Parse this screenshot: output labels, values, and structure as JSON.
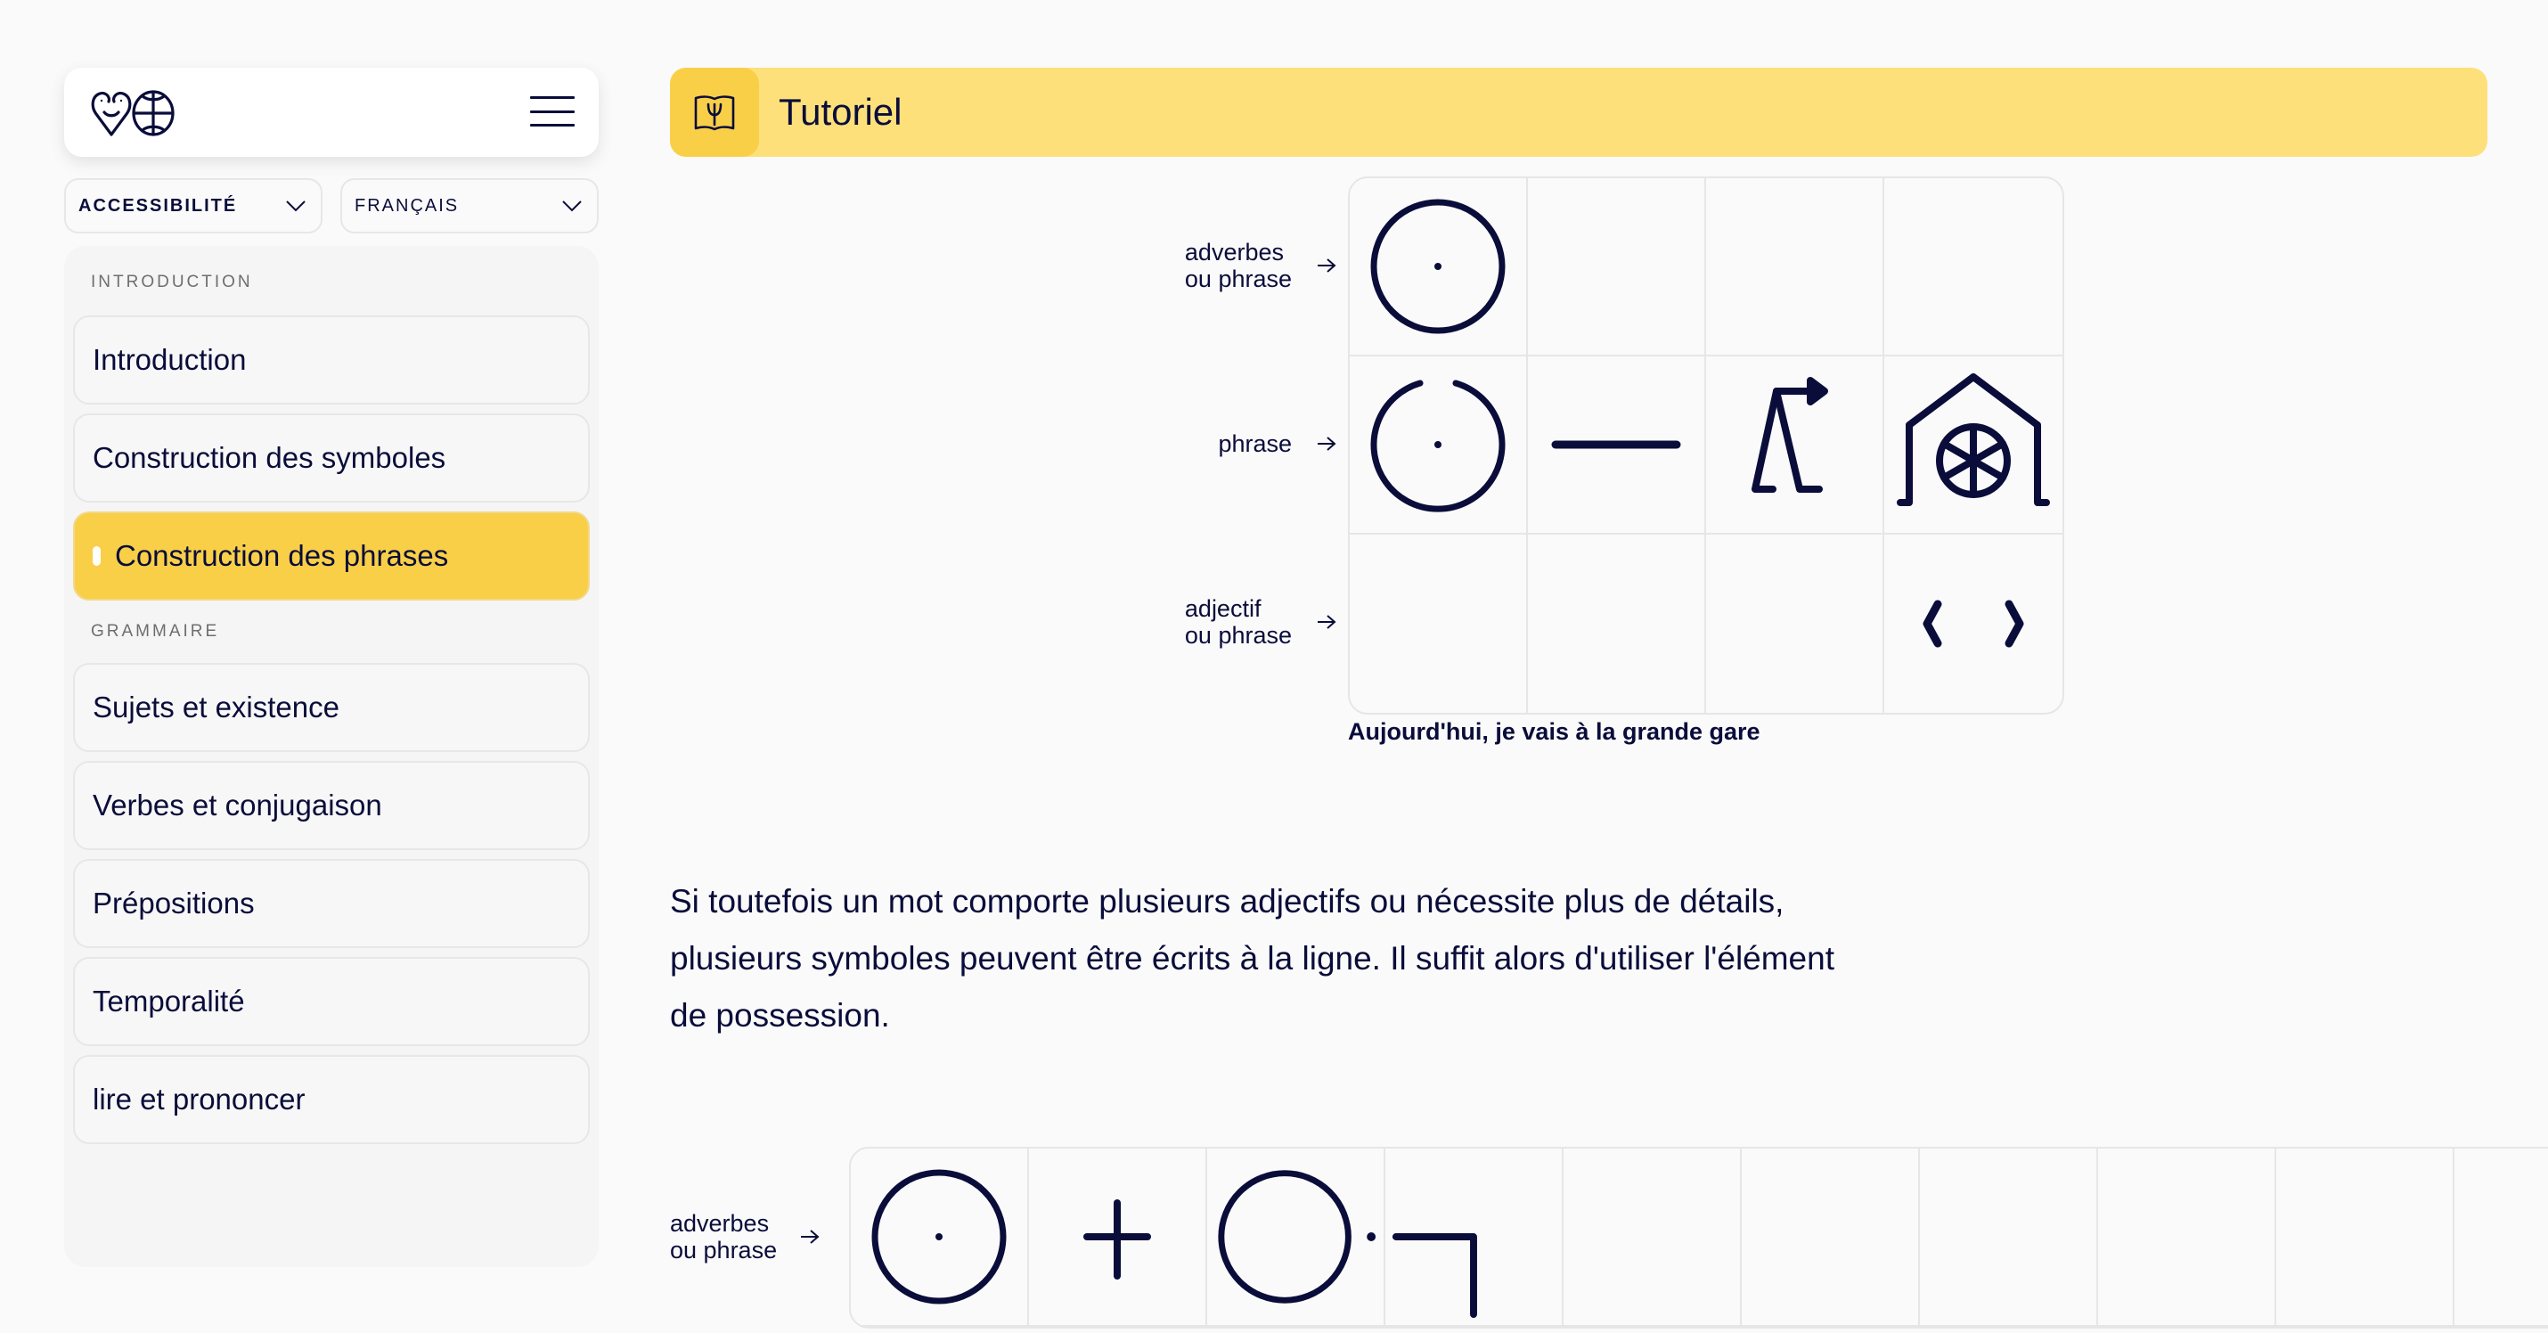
{
  "header": {
    "logo_label": "logo",
    "menu_label": "menu"
  },
  "controls": {
    "accessibility_select": {
      "value": "ACCESSIBILITÉ"
    },
    "language_select": {
      "value": "FRANÇAIS"
    }
  },
  "sidebar": {
    "sections": [
      {
        "label": "INTRODUCTION",
        "items": [
          {
            "label": "Introduction",
            "active": false
          },
          {
            "label": "Construction des symboles",
            "active": false
          },
          {
            "label": "Construction des phrases",
            "active": true
          }
        ]
      },
      {
        "label": "GRAMMAIRE",
        "items": [
          {
            "label": "Sujets et existence",
            "active": false
          },
          {
            "label": "Verbes et conjugaison",
            "active": false
          },
          {
            "label": "Prépositions",
            "active": false
          },
          {
            "label": "Temporalité",
            "active": false
          },
          {
            "label": "lire et prononcer",
            "active": false
          }
        ]
      }
    ]
  },
  "page": {
    "title": "Tutoriel",
    "title_icon": "book-icon",
    "diagram1": {
      "rows": [
        {
          "label_line1": "adverbes",
          "label_line2": "ou phrase",
          "cells": [
            "circle-dot-symbol",
            "",
            "",
            ""
          ]
        },
        {
          "label_line1": "phrase",
          "label_line2": "",
          "cells": [
            "open-circle-dot-symbol",
            "dash-symbol",
            "walk-arrow-symbol",
            "station-wheel-symbol"
          ]
        },
        {
          "label_line1": "adjectif",
          "label_line2": "ou phrase",
          "cells": [
            "",
            "",
            "",
            "chevrons-symbol"
          ]
        }
      ],
      "caption": "Aujourd'hui, je vais à la grande gare"
    },
    "paragraph": "Si toutefois un mot comporte plusieurs adjectifs ou nécessite plus de détails, plusieurs symboles peuvent être écrits à la ligne. Il suffit alors d'utiliser l'élément de possession.",
    "diagram2": {
      "rows": [
        {
          "label_line1": "adverbes",
          "label_line2": "ou phrase",
          "cells": [
            "circle-dot-symbol",
            "plus-symbol",
            "circle-possession-symbol",
            "corner-symbol",
            "",
            "",
            "",
            "",
            "",
            ""
          ]
        }
      ]
    }
  },
  "colors": {
    "ink": "#0a0d3a",
    "accent_yellow": "#f9cf48",
    "header_yellow": "#fde07a",
    "background": "#fafafa"
  }
}
